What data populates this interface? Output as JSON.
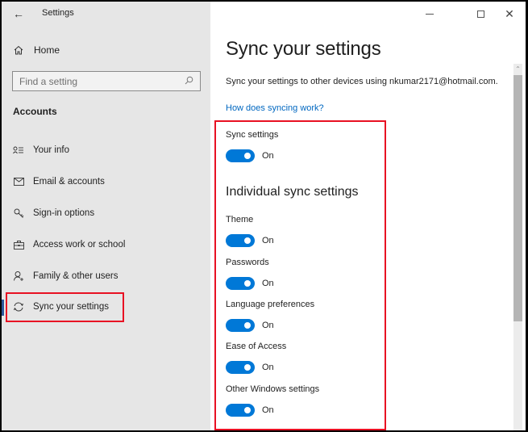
{
  "window": {
    "title": "Settings",
    "controls": {
      "minimize": "minimize",
      "maximize": "maximize",
      "close": "close"
    }
  },
  "sidebar": {
    "home_label": "Home",
    "search": {
      "placeholder": "Find a setting",
      "value": ""
    },
    "section_heading": "Accounts",
    "items": [
      {
        "label": "Your info",
        "icon": "person-list-icon",
        "active": false
      },
      {
        "label": "Email & accounts",
        "icon": "mail-icon",
        "active": false
      },
      {
        "label": "Sign-in options",
        "icon": "key-icon",
        "active": false
      },
      {
        "label": "Access work or school",
        "icon": "briefcase-icon",
        "active": false
      },
      {
        "label": "Family & other users",
        "icon": "person-add-icon",
        "active": false
      },
      {
        "label": "Sync your settings",
        "icon": "sync-icon",
        "active": true
      }
    ]
  },
  "main": {
    "title": "Sync your settings",
    "description": "Sync your settings to other devices using nkumar2171@hotmail.com.",
    "help_link": "How does syncing work?",
    "sync_settings": {
      "label": "Sync settings",
      "state": "On",
      "on": true
    },
    "individual_heading": "Individual sync settings",
    "toggles": [
      {
        "label": "Theme",
        "state": "On",
        "on": true
      },
      {
        "label": "Passwords",
        "state": "On",
        "on": true
      },
      {
        "label": "Language preferences",
        "state": "On",
        "on": true
      },
      {
        "label": "Ease of Access",
        "state": "On",
        "on": true
      },
      {
        "label": "Other Windows settings",
        "state": "On",
        "on": true
      }
    ]
  },
  "colors": {
    "accent": "#0078d7",
    "link": "#0067c0",
    "highlight": "#e81123",
    "sidebar_bg": "#e6e6e6"
  }
}
